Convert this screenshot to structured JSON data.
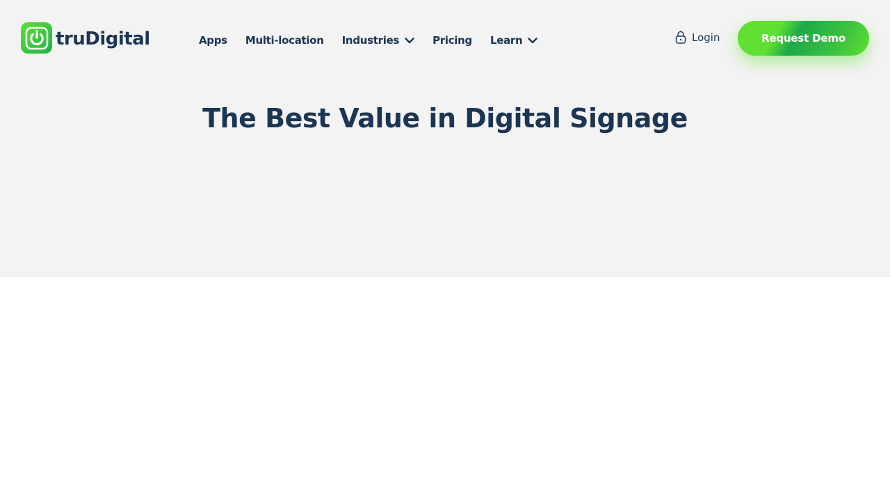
{
  "brand": {
    "name": "truDigital",
    "logo_icon": "power-icon",
    "colors": {
      "green": "#5fe033",
      "dark_green": "#1fb24a",
      "navy": "#1b3553",
      "hero_bg": "#f3f3f3"
    }
  },
  "nav": {
    "items": [
      {
        "label": "Apps",
        "has_dropdown": false
      },
      {
        "label": "Multi-location",
        "has_dropdown": false
      },
      {
        "label": "Industries",
        "has_dropdown": true
      },
      {
        "label": "Pricing",
        "has_dropdown": false
      },
      {
        "label": "Learn",
        "has_dropdown": true
      }
    ]
  },
  "header": {
    "login_label": "Login",
    "login_icon": "lock-icon",
    "cta_label": "Request Demo"
  },
  "hero": {
    "title": "The Best Value in Digital Signage"
  }
}
